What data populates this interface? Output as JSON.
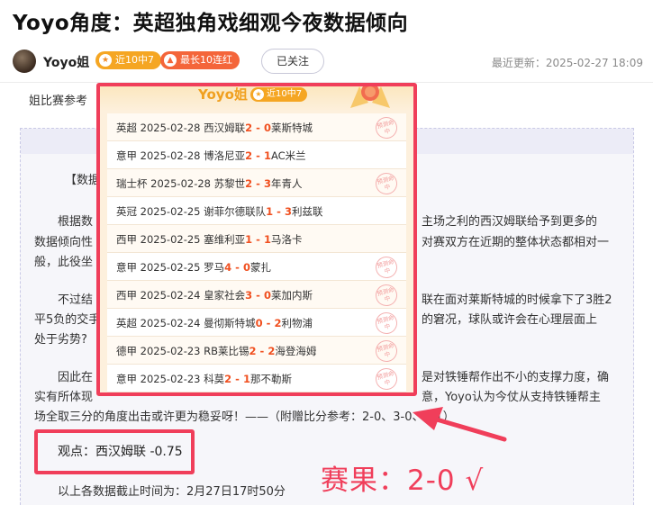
{
  "title": "Yoyo角度：英超独角戏细观今夜数据倾向",
  "author": {
    "name": "Yoyo姐",
    "badge_hit": "近10中7",
    "badge_streak": "最长10连红",
    "follow_label": "已关注",
    "update_time": "最近更新：2025-02-27 18:09"
  },
  "article": {
    "pre_text": "姐比赛参考",
    "heading_fragment": "【数据",
    "p1": {
      "line1_left": "根据数",
      "line1_right": "主场之利的西汉姆联给予到更多的",
      "line2_left": "数据倾向性",
      "line2_right": "对赛双方在近期的整体状态都相对一",
      "line3": "般，此役坐"
    },
    "p2": {
      "line1_left": "不过结",
      "line1_right": "联在面对莱斯特城的时候拿下了3胜2",
      "line2_left": "平5负的交手",
      "line2_right": "的窘况，球队或许会在心理层面上",
      "line3": "处于劣势?"
    },
    "p3": {
      "line1_left": "因此在",
      "line1_right": "是对铁锤帮作出不小的支撑力度，确",
      "line2_left": "实有所体现",
      "line2_right": "意，Yoyo认为今仗从支持铁锤帮主",
      "line3": "场全取三分的角度出击或许更为稳妥呀！——（附赠比分参考：2-0、3-0、2-1）"
    },
    "viewpoint": "观点：西汉姆联 -0.75",
    "result": "赛果：2-0 √",
    "footnote": "以上各数据截止时间为：2月27日17时50分"
  },
  "popup": {
    "title": "Yoyo姐",
    "badge": "近10中7",
    "stamp_text": "预测命中",
    "records": [
      {
        "pre": "英超 2025-02-28 西汉姆联",
        "s1": "2",
        "sep": " - ",
        "s2": "0",
        "post": "莱斯特城",
        "hit": true
      },
      {
        "pre": "意甲 2025-02-28 博洛尼亚",
        "s1": "2",
        "sep": " - ",
        "s2": "1",
        "post": "AC米兰",
        "hit": false
      },
      {
        "pre": "瑞士杯 2025-02-28 苏黎世",
        "s1": "2",
        "sep": " - ",
        "s2": "3",
        "post": "年青人",
        "hit": true
      },
      {
        "pre": "英冠 2025-02-25 谢菲尔德联队",
        "s1": "1",
        "sep": " - ",
        "s2": "3",
        "post": "利兹联",
        "hit": false
      },
      {
        "pre": "西甲 2025-02-25 塞维利亚",
        "s1": "1",
        "sep": " - ",
        "s2": "1",
        "post": "马洛卡",
        "hit": false
      },
      {
        "pre": "意甲 2025-02-25 罗马",
        "s1": "4",
        "sep": " - ",
        "s2": "0",
        "post": "蒙扎",
        "hit": true
      },
      {
        "pre": "西甲 2025-02-24 皇家社会",
        "s1": "3",
        "sep": " - ",
        "s2": "0",
        "post": "莱加内斯",
        "hit": true
      },
      {
        "pre": "英超 2025-02-24 曼彻斯特城",
        "s1": "0",
        "sep": " - ",
        "s2": "2",
        "post": "利物浦",
        "hit": true
      },
      {
        "pre": "德甲 2025-02-23 RB莱比锡",
        "s1": "2",
        "sep": " - ",
        "s2": "2",
        "post": "海登海姆",
        "hit": true
      },
      {
        "pre": "意甲 2025-02-23 科莫",
        "s1": "2",
        "sep": " - ",
        "s2": "1",
        "post": "那不勒斯",
        "hit": true
      }
    ]
  },
  "colors": {
    "accent_red": "#f03e5a",
    "score_orange": "#f05020",
    "badge_orange": "#f5a623",
    "badge_red": "#f4653a"
  },
  "icons": {
    "avatar": "avatar",
    "badge_hit_icon": "star-icon",
    "badge_streak_icon": "flame-icon",
    "popup_medal": "medal-icon",
    "hit_stamp": "hit-stamp-icon",
    "annotation_arrow": "arrow-icon"
  }
}
